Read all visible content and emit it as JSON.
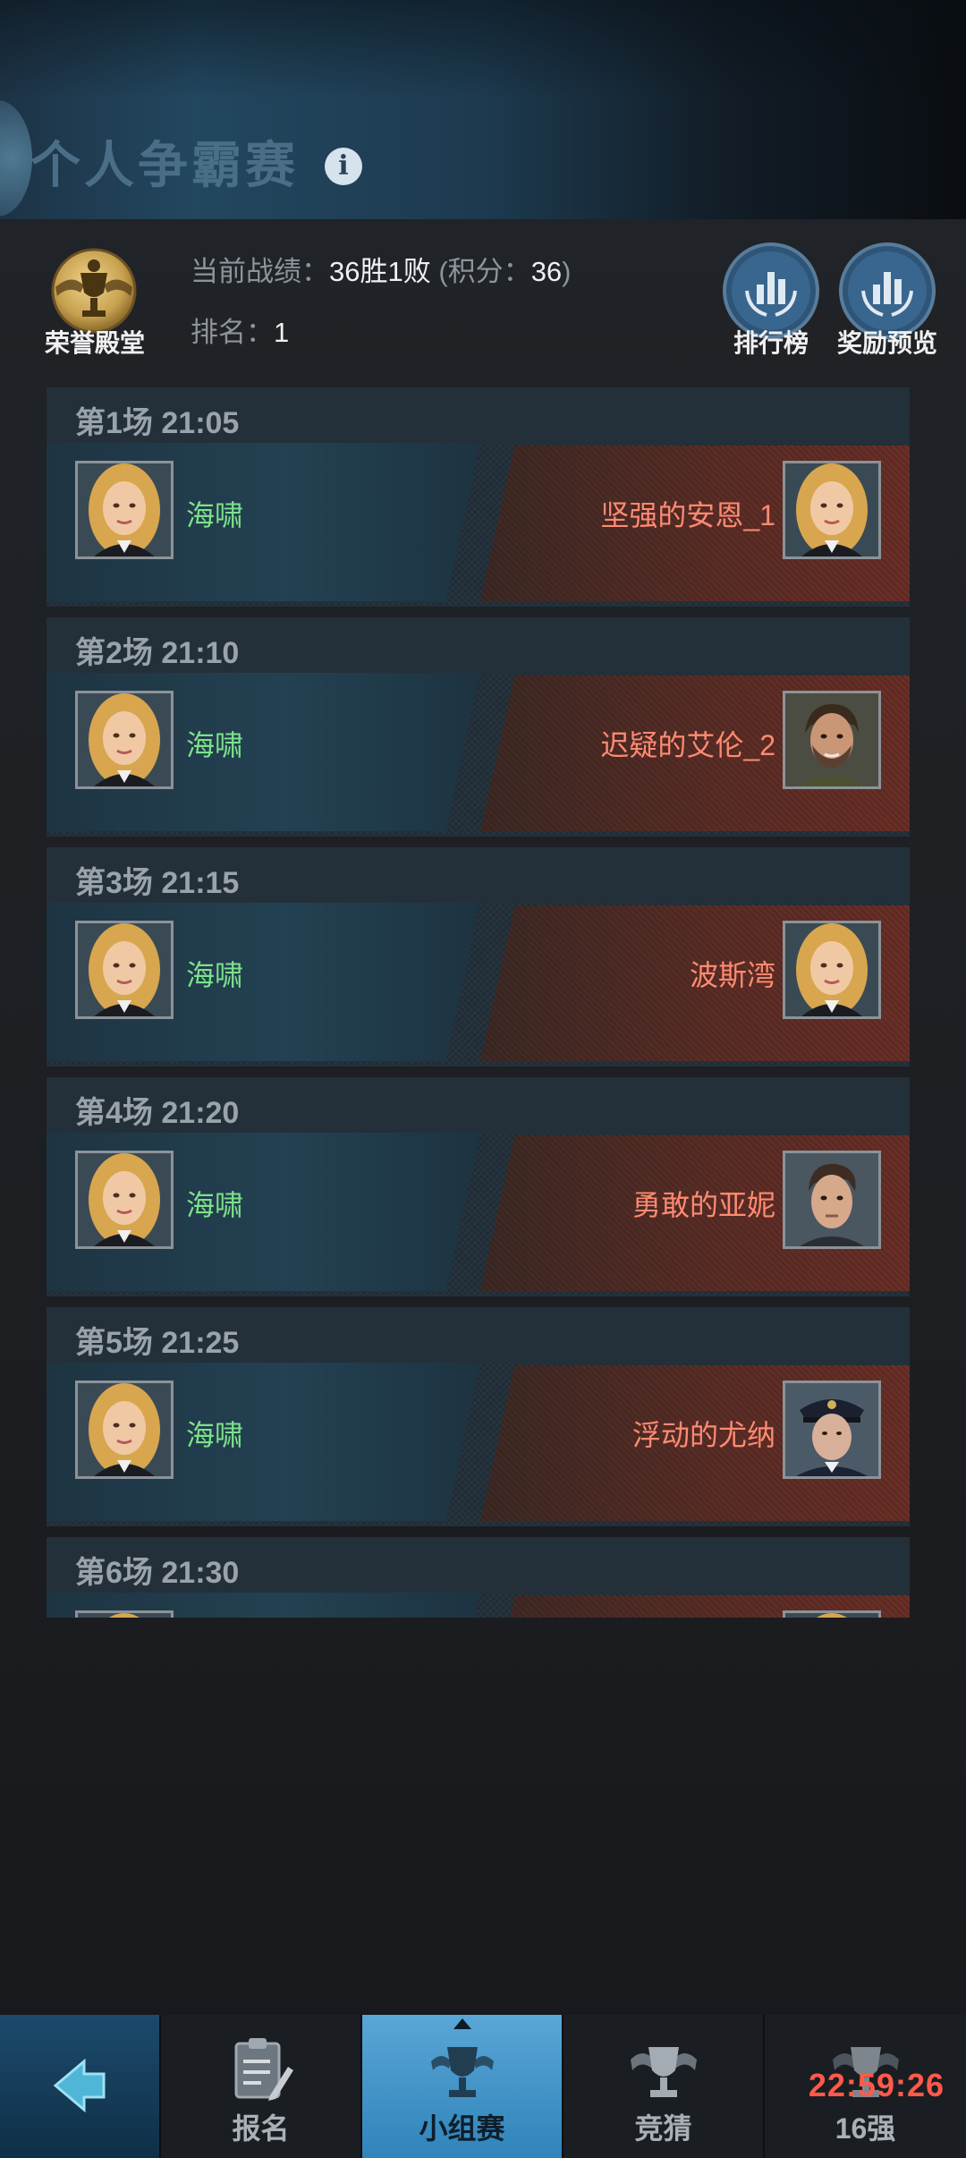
{
  "header": {
    "title": "个人争霸赛",
    "info_icon": "info-icon"
  },
  "stats": {
    "emblem_label": "荣誉殿堂",
    "record_label": "当前战绩：",
    "record_value": "36胜1败",
    "points_prefix": "(积分：",
    "points_value": "36",
    "points_suffix": ")",
    "rank_label": "排名：",
    "rank_value": "1"
  },
  "buttons": {
    "leaderboard": "排行榜",
    "reward_preview": "奖励预览"
  },
  "matches": [
    {
      "round": "第1场",
      "time": "21:05",
      "player": "海啸",
      "opponent": "坚强的安恩_1",
      "opponent_avatar": "blonde-woman"
    },
    {
      "round": "第2场",
      "time": "21:10",
      "player": "海啸",
      "opponent": "迟疑的艾伦_2",
      "opponent_avatar": "bearded-man"
    },
    {
      "round": "第3场",
      "time": "21:15",
      "player": "海啸",
      "opponent": "波斯湾",
      "opponent_avatar": "blonde-woman"
    },
    {
      "round": "第4场",
      "time": "21:20",
      "player": "海啸",
      "opponent": "勇敢的亚妮",
      "opponent_avatar": "young-man"
    },
    {
      "round": "第5场",
      "time": "21:25",
      "player": "海啸",
      "opponent": "浮动的尤纳",
      "opponent_avatar": "captain"
    },
    {
      "round": "第6场",
      "time": "21:30",
      "player": "",
      "opponent": "",
      "opponent_avatar": "blonde-woman"
    }
  ],
  "nav": {
    "back": "back-arrow-icon",
    "signup": "报名",
    "group_stage": "小组赛",
    "guess": "竞猜",
    "top16": "16强",
    "countdown": "22:59:26"
  },
  "colors": {
    "player_name": "#7de28b",
    "opponent_name": "#ff8a72",
    "active_tab": "#2f84ba",
    "countdown": "#ff5a4a"
  }
}
